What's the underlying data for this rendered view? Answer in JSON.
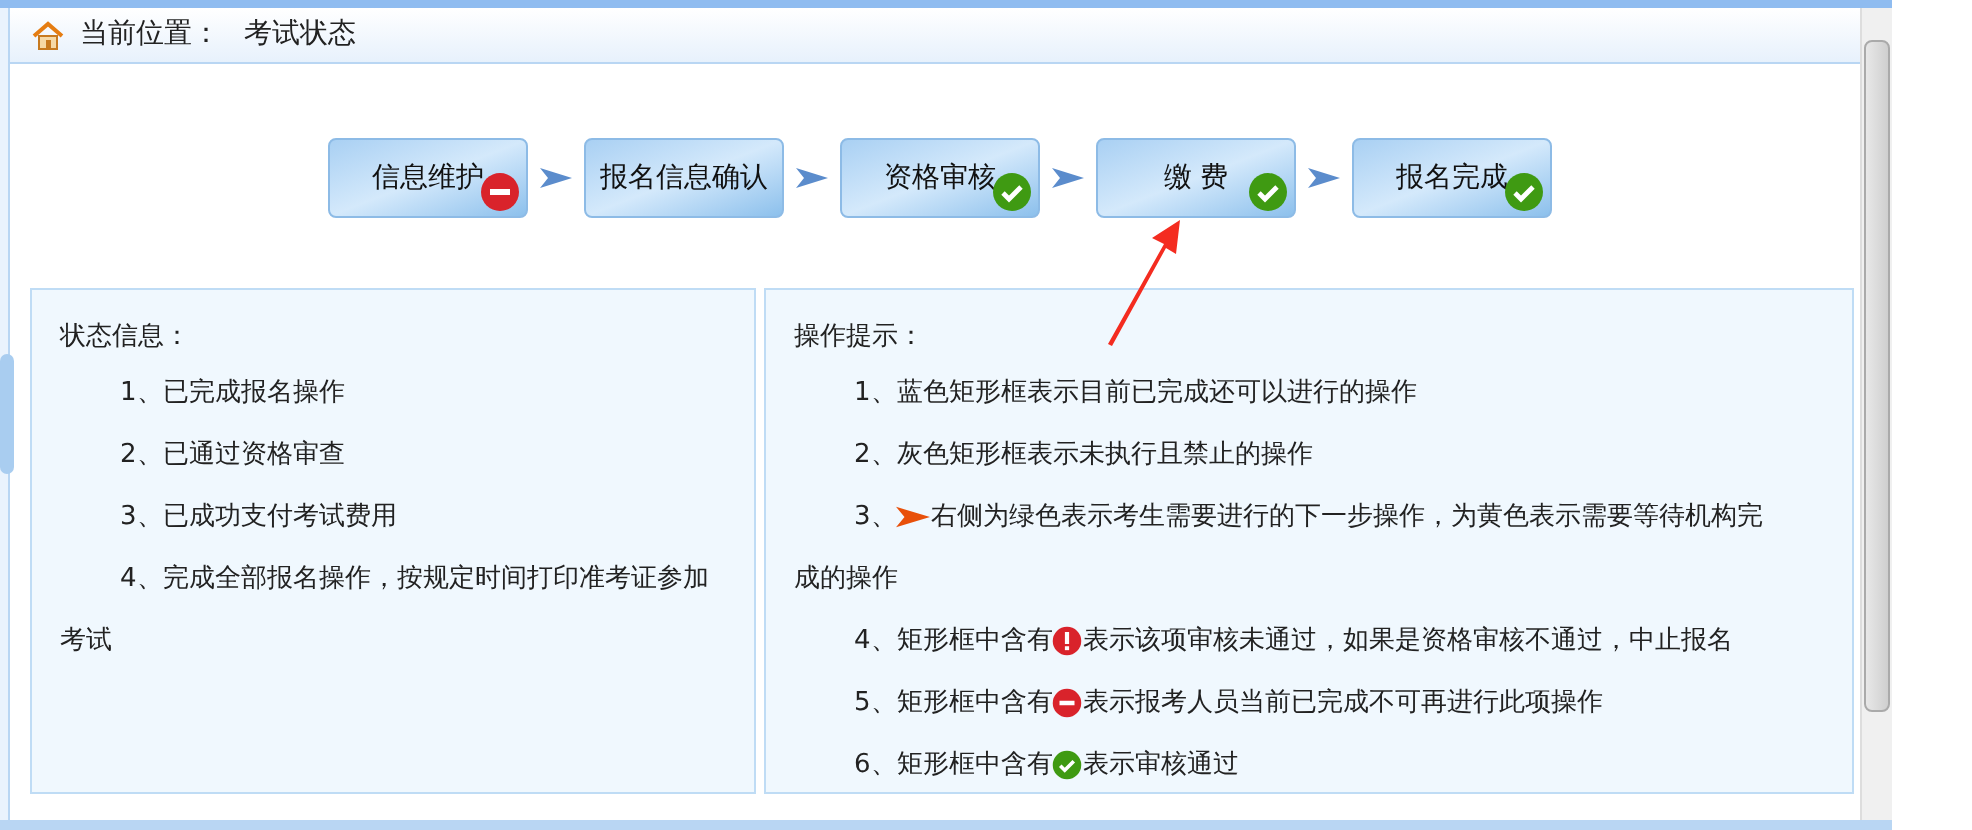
{
  "breadcrumb": {
    "label": "当前位置：",
    "value": "考试状态"
  },
  "steps": [
    {
      "label": "信息维护",
      "kind": "minus"
    },
    {
      "label": "报名信息确认",
      "kind": "plain"
    },
    {
      "label": "资格审核",
      "kind": "check"
    },
    {
      "label": "缴 费",
      "kind": "check"
    },
    {
      "label": "报名完成",
      "kind": "check"
    }
  ],
  "status_panel": {
    "title": "状态信息：",
    "items": [
      "1、已完成报名操作",
      "2、已通过资格审查",
      "3、已成功支付考试费用",
      "4、完成全部报名操作，按规定时间打印准考证参加考试"
    ]
  },
  "tips_panel": {
    "title": "操作提示：",
    "items": [
      {
        "number": "1、",
        "kind": "plain",
        "text": "蓝色矩形框表示目前已完成还可以进行的操作"
      },
      {
        "number": "2、",
        "kind": "plain",
        "text": "灰色矩形框表示未执行且禁止的操作"
      },
      {
        "number": "3、",
        "kind": "arrow",
        "text": "右侧为绿色表示考生需要进行的下一步操作，为黄色表示需要等待机构完",
        "continuation": "成的操作"
      },
      {
        "number": "4、",
        "kind": "error",
        "text": "矩形框中含有",
        "after": "表示该项审核未通过，如果是资格审核不通过，中止报名"
      },
      {
        "number": "5、",
        "kind": "minus",
        "text": "矩形框中含有",
        "after": "表示报考人员当前已完成不可再进行此项操作"
      },
      {
        "number": "6、",
        "kind": "check",
        "text": "矩形框中含有",
        "after": "表示审核通过"
      }
    ]
  }
}
